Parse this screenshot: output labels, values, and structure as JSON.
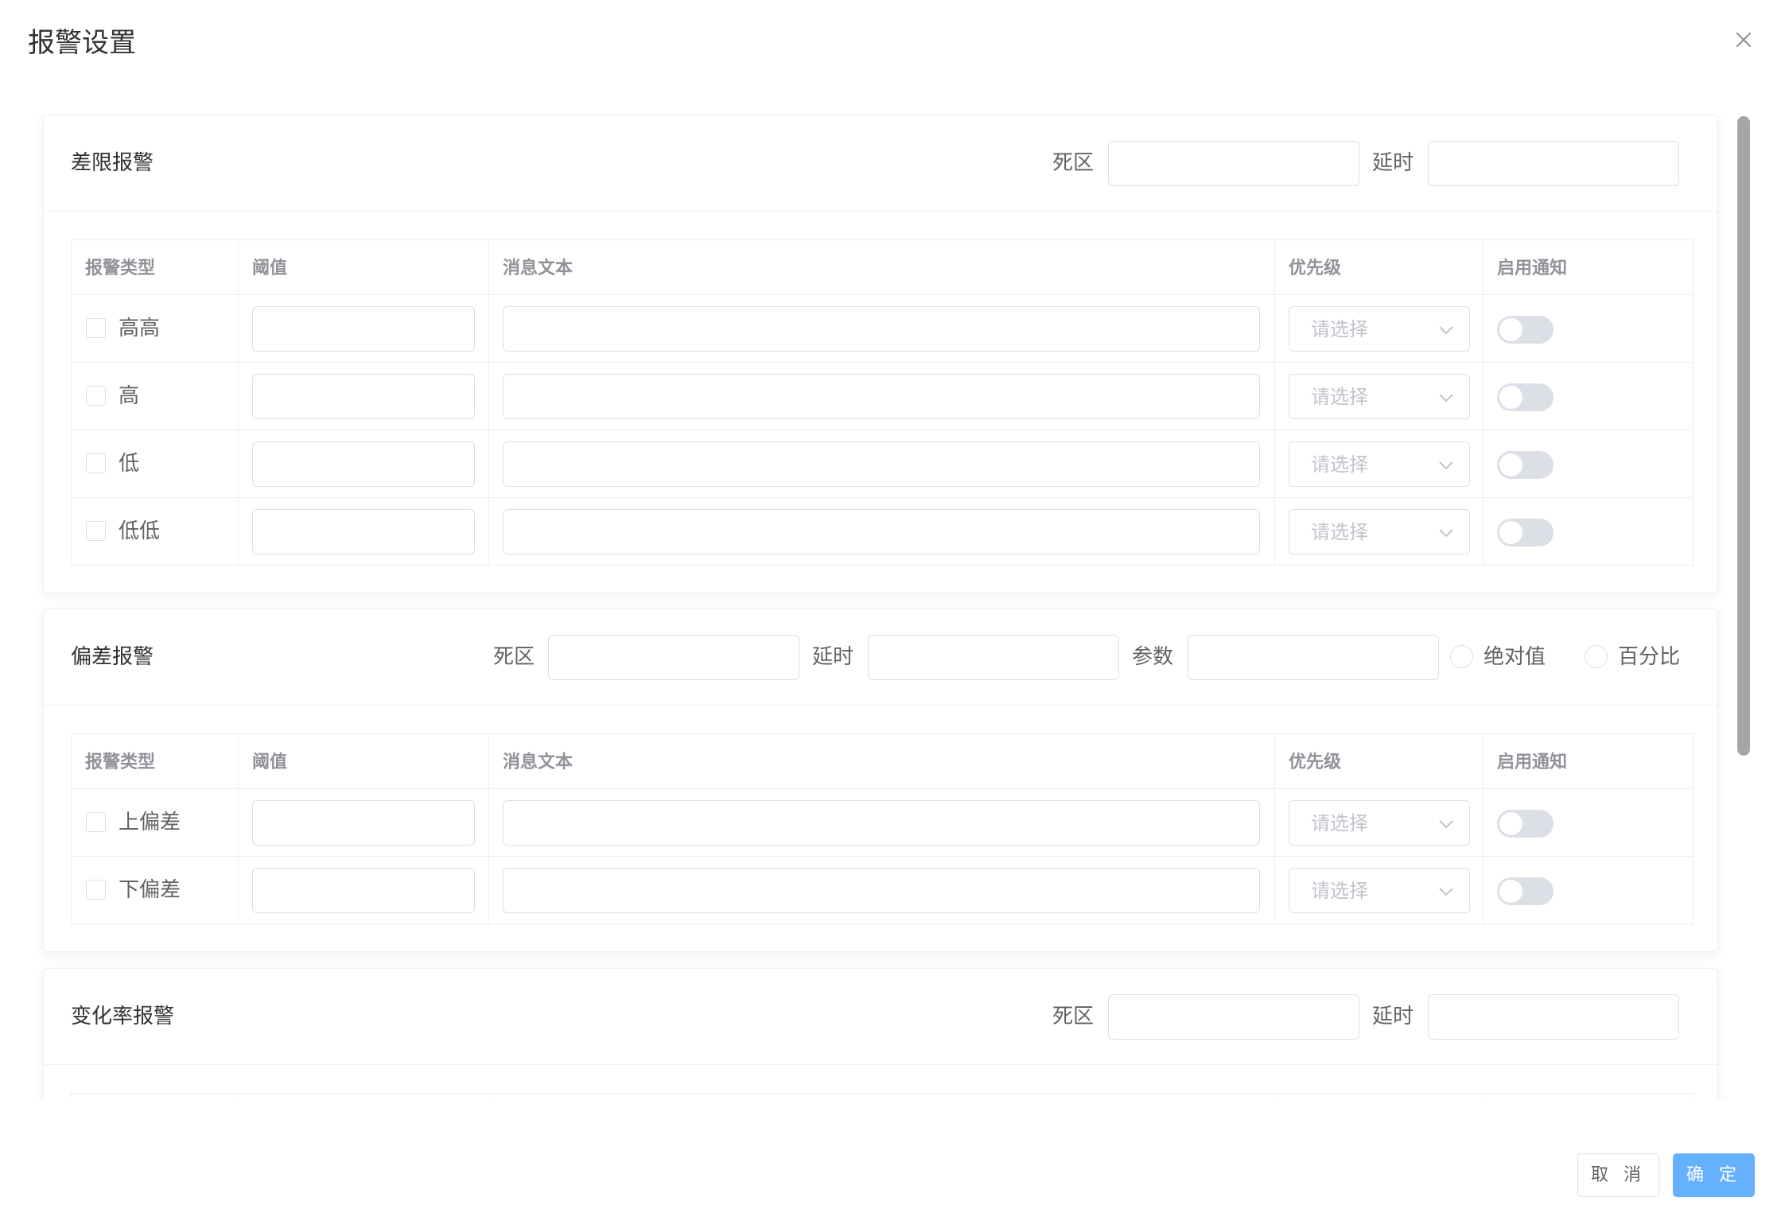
{
  "dialog": {
    "title": "报警设置",
    "close_icon": "close-icon"
  },
  "limit_alarm": {
    "title": "差限报警",
    "deadband_label": "死区",
    "deadband_value": "",
    "delay_label": "延时",
    "delay_value": "",
    "columns": [
      "报警类型",
      "阈值",
      "消息文本",
      "优先级",
      "启用通知"
    ],
    "rows": [
      {
        "type": "高高",
        "threshold": "",
        "message": "",
        "priority_placeholder": "请选择",
        "checked": false,
        "notify": false
      },
      {
        "type": "高",
        "threshold": "",
        "message": "",
        "priority_placeholder": "请选择",
        "checked": false,
        "notify": false
      },
      {
        "type": "低",
        "threshold": "",
        "message": "",
        "priority_placeholder": "请选择",
        "checked": false,
        "notify": false
      },
      {
        "type": "低低",
        "threshold": "",
        "message": "",
        "priority_placeholder": "请选择",
        "checked": false,
        "notify": false
      }
    ]
  },
  "deviation_alarm": {
    "title": "偏差报警",
    "deadband_label": "死区",
    "deadband_value": "",
    "delay_label": "延时",
    "delay_value": "",
    "param_label": "参数",
    "param_value": "",
    "radio_absolute": "绝对值",
    "radio_percent": "百分比",
    "columns": [
      "报警类型",
      "阈值",
      "消息文本",
      "优先级",
      "启用通知"
    ],
    "rows": [
      {
        "type": "上偏差",
        "threshold": "",
        "message": "",
        "priority_placeholder": "请选择",
        "checked": false,
        "notify": false
      },
      {
        "type": "下偏差",
        "threshold": "",
        "message": "",
        "priority_placeholder": "请选择",
        "checked": false,
        "notify": false
      }
    ]
  },
  "rate_alarm": {
    "title": "变化率报警",
    "deadband_label": "死区",
    "deadband_value": "",
    "delay_label": "延时",
    "delay_value": ""
  },
  "footer": {
    "cancel_label": "取 消",
    "ok_label": "确 定"
  },
  "colors": {
    "primary": "#66b1ff",
    "border": "#dcdfe6",
    "divider": "#ebeef5",
    "switch_off": "#dcdfe6",
    "placeholder": "#c0c4cc",
    "scrollbar": "#a4a6aa"
  }
}
